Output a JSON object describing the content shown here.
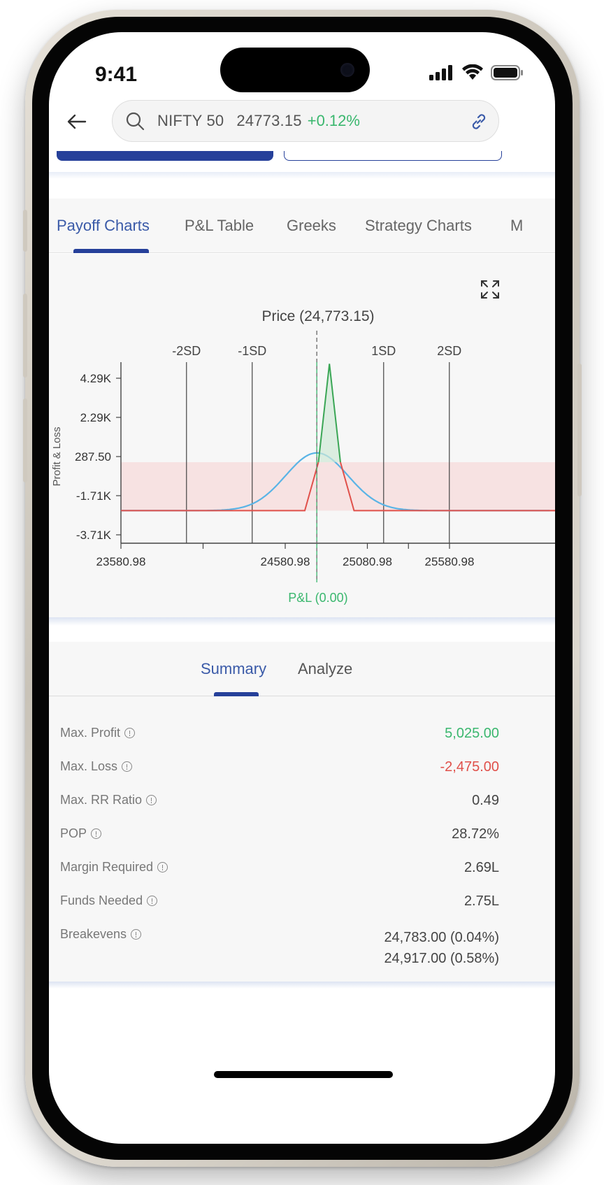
{
  "status": {
    "time": "9:41"
  },
  "search": {
    "symbol": "NIFTY 50",
    "price": "24773.15",
    "change": "+0.12%"
  },
  "tabs": [
    {
      "label": "Payoff Charts",
      "active": true
    },
    {
      "label": "P&L Table",
      "active": false
    },
    {
      "label": "Greeks",
      "active": false
    },
    {
      "label": "Strategy Charts",
      "active": false
    },
    {
      "label": "M",
      "active": false
    }
  ],
  "chart": {
    "price_label": "Price (24,773.15)",
    "pnl_label": "P&L (0.00)",
    "ylabel": "Profit & Loss",
    "sd_labels": [
      "-2SD",
      "-1SD",
      "1SD",
      "2SD"
    ],
    "y_ticks": [
      "4.29K",
      "2.29K",
      "287.50",
      "-1.71K",
      "-3.71K"
    ],
    "x_ticks": [
      "23580.98",
      "24580.98",
      "25080.98",
      "25580.98"
    ]
  },
  "chart_data": {
    "type": "line",
    "xlabel": "",
    "ylabel": "Profit & Loss",
    "current_price": 24773.15,
    "x_ticks": [
      23580.98,
      24580.98,
      25080.98,
      25580.98
    ],
    "y_ticks": [
      4290,
      2290,
      287.5,
      -1710,
      -3710
    ],
    "series": [
      {
        "x": [
          23580.98,
          24700,
          24783,
          24850,
          24917,
          25000,
          26000
        ],
        "values": [
          -2475,
          -2475,
          0,
          5025,
          0,
          -2475,
          -2475
        ]
      }
    ],
    "grid": false
  },
  "summary": {
    "tabs": [
      "Summary",
      "Analyze"
    ],
    "rows": [
      {
        "label": "Max. Profit",
        "value": "5,025.00",
        "color": "#3ab76e"
      },
      {
        "label": "Max. Loss",
        "value": "-2,475.00",
        "color": "#e0504a"
      },
      {
        "label": "Max. RR Ratio",
        "value": "0.49"
      },
      {
        "label": "POP",
        "value": "28.72%"
      },
      {
        "label": "Margin Required",
        "value": "2.69L"
      },
      {
        "label": "Funds Needed",
        "value": "2.75L"
      },
      {
        "label": "Breakevens",
        "value": "24,783.00 (0.04%)",
        "value2": "24,917.00 (0.58%)"
      }
    ]
  },
  "colors": {
    "accent": "#26409a",
    "profit": "#3ab76e",
    "loss": "#e0504a",
    "prob_curve": "#5ab4e6"
  }
}
